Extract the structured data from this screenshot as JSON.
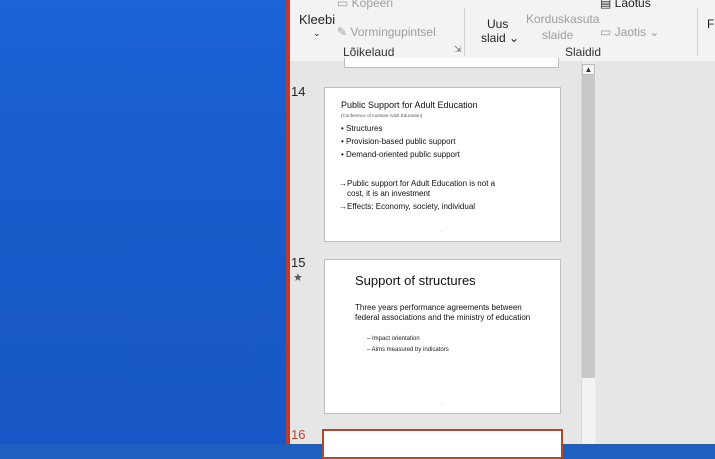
{
  "ribbon": {
    "paste_label": "Kleebi",
    "copy_label": "Kopeeri",
    "format_painter_label": "Vormingupintsel",
    "clipboard_group": "Lõikelaud",
    "new_slide_label_1": "Uus",
    "new_slide_label_2": "slaid",
    "reuse_slides_label_1": "Korduskasuta",
    "reuse_slides_label_2": "slaide",
    "layout_label": "Laotus",
    "sections_label": "Jaotis",
    "slides_group": "Slaidid",
    "next_group_initial": "F"
  },
  "slides": [
    {
      "number": "14",
      "title": "Public Support for Adult Education",
      "subtitle": "(Conference of Austrian Adult Education)",
      "bullets": [
        "Structures",
        "Provision-based public support",
        "Demand-oriented public support"
      ],
      "arrow_1_line_1": "→Public support for Adult Education is not a",
      "arrow_1_line_2": "cost, it is an investment",
      "arrow_2": "→Effects: Economy, society, individual",
      "page": "\""
    },
    {
      "number": "15",
      "star": "★",
      "title": "Support of structures",
      "body": "Three years performance agreements between federal associations and the ministry of education",
      "sub_1": "– Impact orientation",
      "sub_2": "– Aims measured by indicators",
      "page": "\""
    },
    {
      "number": "16"
    }
  ]
}
